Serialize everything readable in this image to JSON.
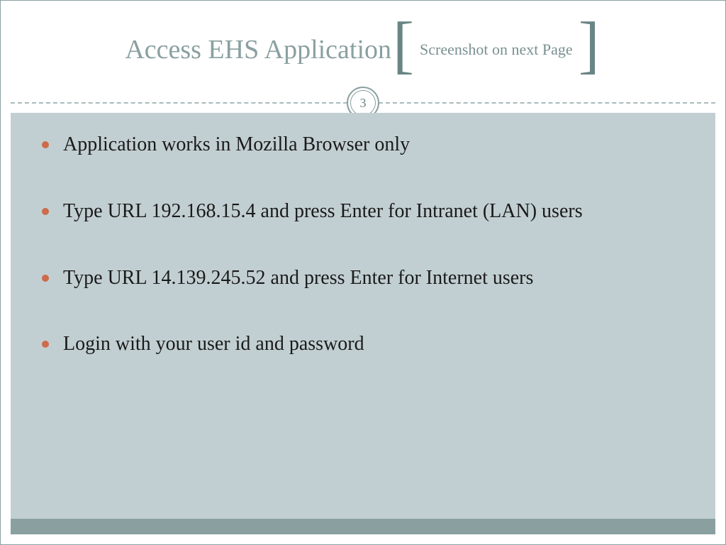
{
  "header": {
    "title_main": "Access EHS Application",
    "bracket_left": "[",
    "subtitle": "Screenshot on next Page",
    "bracket_right": "]"
  },
  "page_number": "3",
  "bullets": [
    "Application works in Mozilla Browser only",
    "Type URL 192.168.15.4 and press Enter for Intranet (LAN) users",
    "Type URL 14.139.245.52 and press Enter for Internet users",
    "Login with your user id and password"
  ],
  "colors": {
    "accent": "#8aa0a0",
    "body_bg": "#c2cfd2",
    "bullet_dot": "#cd6b4a",
    "title_text": "#8aa0a0"
  }
}
